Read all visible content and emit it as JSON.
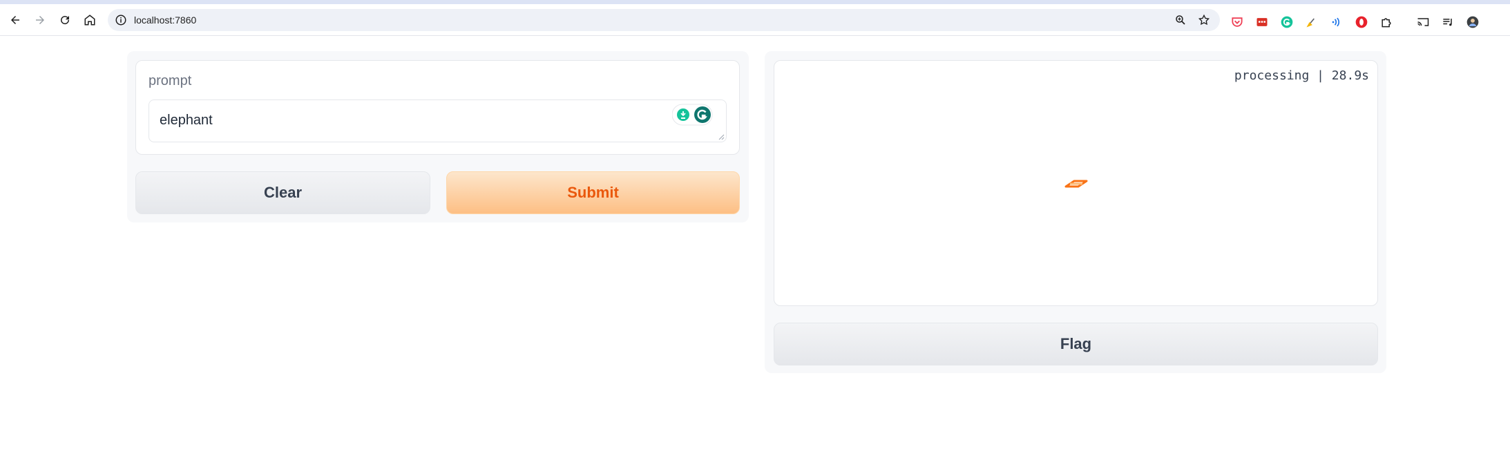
{
  "browser": {
    "url": "localhost:7860",
    "colors": {
      "toolbar_bg": "#ffffff",
      "omnibox_bg": "#eef1f7"
    },
    "toolbar_icons": [
      "back-icon",
      "forward-icon",
      "reload-icon",
      "home-icon"
    ],
    "extensions": [
      "pocket-icon",
      "ext-red-icon",
      "grammarly-icon",
      "broom-icon",
      "wave-icon",
      "opera-icon",
      "puzzle-icon",
      "cast-icon",
      "media-icon",
      "profile-avatar"
    ]
  },
  "app": {
    "colors": {
      "accent": "#ea580c",
      "submit_bg": "#fdbf84",
      "neutral_btn": "#e5e7eb"
    },
    "input": {
      "label": "prompt",
      "value": "elephant"
    },
    "buttons": {
      "clear": "Clear",
      "submit": "Submit",
      "flag": "Flag"
    },
    "output": {
      "status": "processing | 28.9s"
    }
  }
}
